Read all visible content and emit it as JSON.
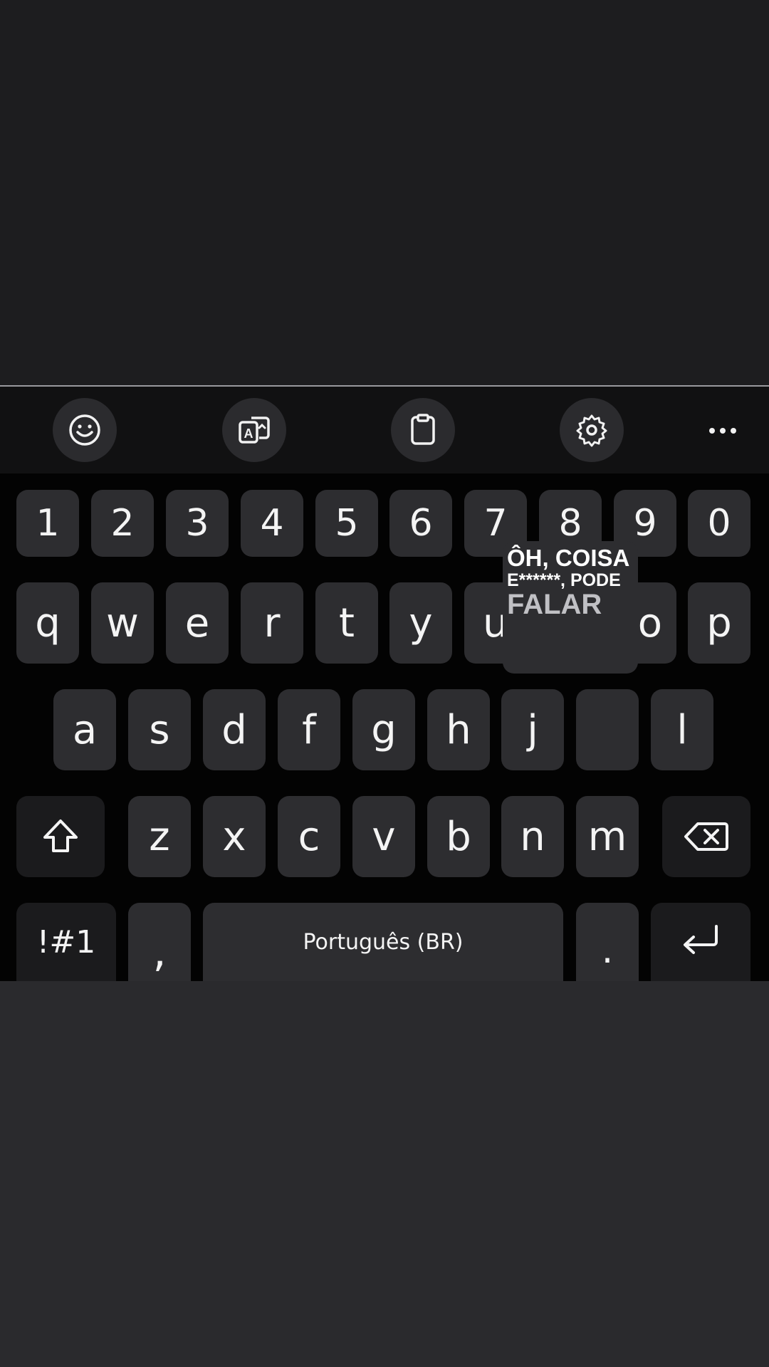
{
  "toolbar": {
    "items": [
      {
        "name": "emoji",
        "icon": "emoji-icon"
      },
      {
        "name": "translate",
        "icon": "translate-icon"
      },
      {
        "name": "clipboard",
        "icon": "clipboard-icon"
      },
      {
        "name": "settings",
        "icon": "gear-icon"
      },
      {
        "name": "more",
        "icon": "more-dots-icon"
      }
    ]
  },
  "keyboard": {
    "number_row": [
      "1",
      "2",
      "3",
      "4",
      "5",
      "6",
      "7",
      "8",
      "9",
      "0"
    ],
    "row_q": [
      "q",
      "w",
      "e",
      "r",
      "t",
      "y",
      "u",
      "",
      "o",
      "p"
    ],
    "row_a": [
      "a",
      "s",
      "d",
      "f",
      "g",
      "h",
      "j",
      "",
      "l"
    ],
    "row_z": [
      "z",
      "x",
      "c",
      "v",
      "b",
      "n",
      "m"
    ],
    "symbols_label": "!#1",
    "comma_label": ",",
    "space_label": "Português (BR)",
    "period_label": ".",
    "shift_icon": "shift-arrow-icon",
    "backspace_icon": "backspace-icon",
    "enter_icon": "enter-return-icon"
  },
  "caption": {
    "line1": "ÔH, COISA",
    "line2": "E******, PODE",
    "line3": "FALAR"
  },
  "colors": {
    "background": "#1d1d1f",
    "keyboard": "#030303",
    "key": "#2d2d30",
    "key_text": "#f4f4f4"
  }
}
